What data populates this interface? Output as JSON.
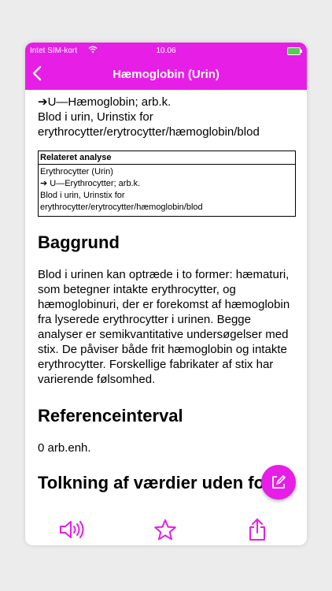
{
  "status_bar": {
    "carrier": "Intet SIM-kort",
    "time": "10.06"
  },
  "nav": {
    "title": "Hæmoglobin (Urin)",
    "back_icon": "chevron-left-icon"
  },
  "content": {
    "intro_lines": [
      "➔U—Hæmoglobin; arb.k.",
      "Blod i urin, Urinstix for",
      "erythrocytter/erytrocytter/hæmoglobin/blod"
    ],
    "related": {
      "header": "Relateret analyse",
      "lines": [
        "Erythrocytter (Urin)",
        "➔ U—Erythrocytter; arb.k.",
        "Blod i urin, Urinstix for",
        "erythrocytter/erytrocytter/hæmoglobin/blod"
      ]
    },
    "baggrund_heading": "Baggrund",
    "baggrund_text": "Blod i urinen kan optræde i to former: hæmaturi, som betegner intakte erythrocytter, og hæmoglobinuri, der er forekomst af hæmoglobin fra lyserede erythrocytter i urinen. Begge analyser er semikvantitative undersøgelser med stix. De påviser både frit hæmoglobin og intakte erythrocytter. Forskellige fabrikater af stix har varierende følsomhed.",
    "reference_heading": "Referenceinterval",
    "reference_value": "0 arb.enh.",
    "tolkning_heading": "Tolkning af værdier uden for"
  },
  "toolbar": {
    "speaker_icon": "speaker-icon",
    "star_icon": "star-icon",
    "share_icon": "share-icon",
    "edit_icon": "edit-icon"
  },
  "colors": {
    "accent": "#e61ee6",
    "battery": "#5cc85c"
  }
}
